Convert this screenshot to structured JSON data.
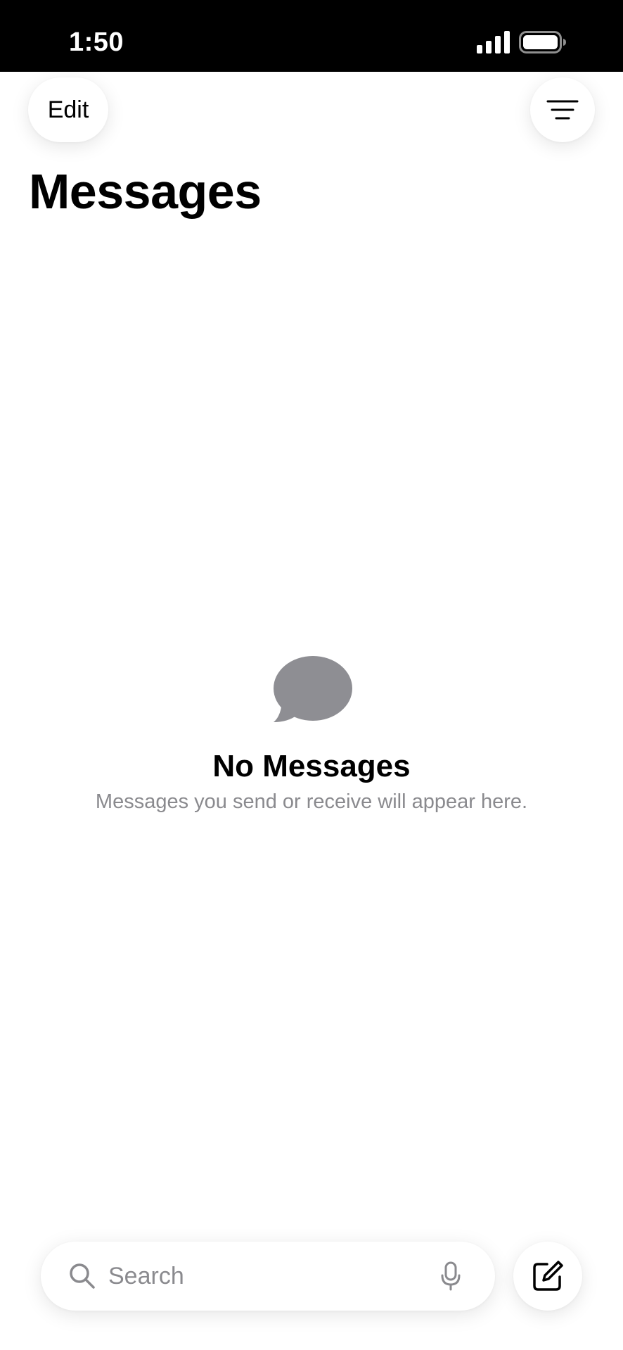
{
  "status_bar": {
    "time": "1:50",
    "signal_icon": "cellular-signal-icon",
    "battery_icon": "battery-full-icon"
  },
  "header": {
    "edit_label": "Edit",
    "filter_icon": "filter-lines-icon",
    "title": "Messages"
  },
  "empty_state": {
    "icon": "message-bubble-icon",
    "title": "No Messages",
    "subtitle": "Messages you send or receive will appear here."
  },
  "bottom_bar": {
    "search_placeholder": "Search",
    "search_value": "",
    "search_icon": "magnifier-icon",
    "mic_icon": "microphone-icon",
    "compose_icon": "compose-icon"
  },
  "colors": {
    "status_bar_bg": "#000000",
    "background": "#ffffff",
    "secondary_text": "#8a8a8e",
    "bubble_gray": "#8e8e93"
  }
}
